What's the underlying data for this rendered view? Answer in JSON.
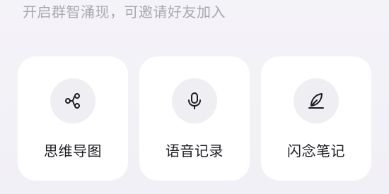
{
  "subtitle": "开启群智涌现，可邀请好友加入",
  "cards": [
    {
      "label": "思维导图",
      "icon": "mind-map-icon"
    },
    {
      "label": "语音记录",
      "icon": "microphone-icon"
    },
    {
      "label": "闪念笔记",
      "icon": "feather-icon"
    }
  ],
  "colors": {
    "background": "#f3f2f7",
    "card": "#ffffff",
    "icon_bg": "#efeff3",
    "icon_stroke": "#1b1b22",
    "subtitle": "#a9a8b0",
    "label": "#1b1b22"
  }
}
